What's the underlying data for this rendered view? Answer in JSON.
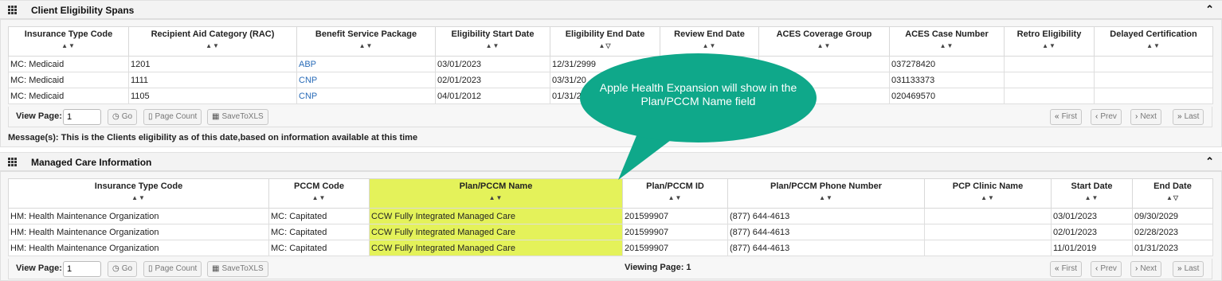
{
  "eligibility": {
    "title": "Client Eligibility Spans",
    "collapse_icon": "chevron-up-icon",
    "columns": [
      "Insurance Type Code",
      "Recipient Aid Category (RAC)",
      "Benefit Service Package",
      "Eligibility Start Date",
      "Eligibility End Date",
      "Review End Date",
      "ACES Coverage Group",
      "ACES Case Number",
      "Retro Eligibility",
      "Delayed Certification"
    ],
    "sort_default": "▲▼",
    "sort_desc": "▲▽",
    "rows": [
      [
        "MC: Medicaid",
        "1201",
        "ABP",
        "03/01/2023",
        "12/31/2999",
        "",
        "",
        "037278420",
        "",
        ""
      ],
      [
        "MC: Medicaid",
        "1111",
        "CNP",
        "02/01/2023",
        "03/31/20",
        "",
        "",
        "031133373",
        "",
        ""
      ],
      [
        "MC: Medicaid",
        "1105",
        "CNP",
        "04/01/2012",
        "01/31/20",
        "",
        "",
        "020469570",
        "",
        ""
      ]
    ],
    "pager": {
      "view_page_label": "View Page:",
      "page_value": "1",
      "go": "Go",
      "page_count": "Page Count",
      "save": "SaveToXLS",
      "first": "First",
      "prev": "Prev",
      "next": "Next",
      "last": "Last"
    },
    "message": "Message(s): This is the Clients eligibility as of this date,based on information available at this time"
  },
  "managed_care": {
    "title": "Managed Care Information",
    "collapse_icon": "chevron-up-icon",
    "columns": [
      "Insurance Type Code",
      "PCCM Code",
      "Plan/PCCM Name",
      "Plan/PCCM ID",
      "Plan/PCCM Phone Number",
      "PCP Clinic Name",
      "Start Date",
      "End Date"
    ],
    "sort_default": "▲▼",
    "sort_asc": "▲▽",
    "rows": [
      [
        "HM: Health Maintenance Organization",
        "MC: Capitated",
        "CCW Fully Integrated Managed Care",
        "201599907",
        "(877) 644-4613",
        "",
        "03/01/2023",
        "09/30/2029"
      ],
      [
        "HM: Health Maintenance Organization",
        "MC: Capitated",
        "CCW Fully Integrated Managed Care",
        "201599907",
        "(877) 644-4613",
        "",
        "02/01/2023",
        "02/28/2023"
      ],
      [
        "HM: Health Maintenance Organization",
        "MC: Capitated",
        "CCW Fully Integrated Managed Care",
        "201599907",
        "(877) 644-4613",
        "",
        "11/01/2019",
        "01/31/2023"
      ]
    ],
    "pager": {
      "view_page_label": "View Page:",
      "page_value": "1",
      "go": "Go",
      "page_count": "Page Count",
      "save": "SaveToXLS",
      "viewing": "Viewing Page: 1",
      "first": "First",
      "prev": "Prev",
      "next": "Next",
      "last": "Last"
    }
  },
  "callout": {
    "text": "Apple Health Expansion will show in the Plan/PCCM Name field",
    "color": "#0fa88a"
  },
  "colors": {
    "highlight": "#e4f25a",
    "link": "#2a6cb8"
  }
}
